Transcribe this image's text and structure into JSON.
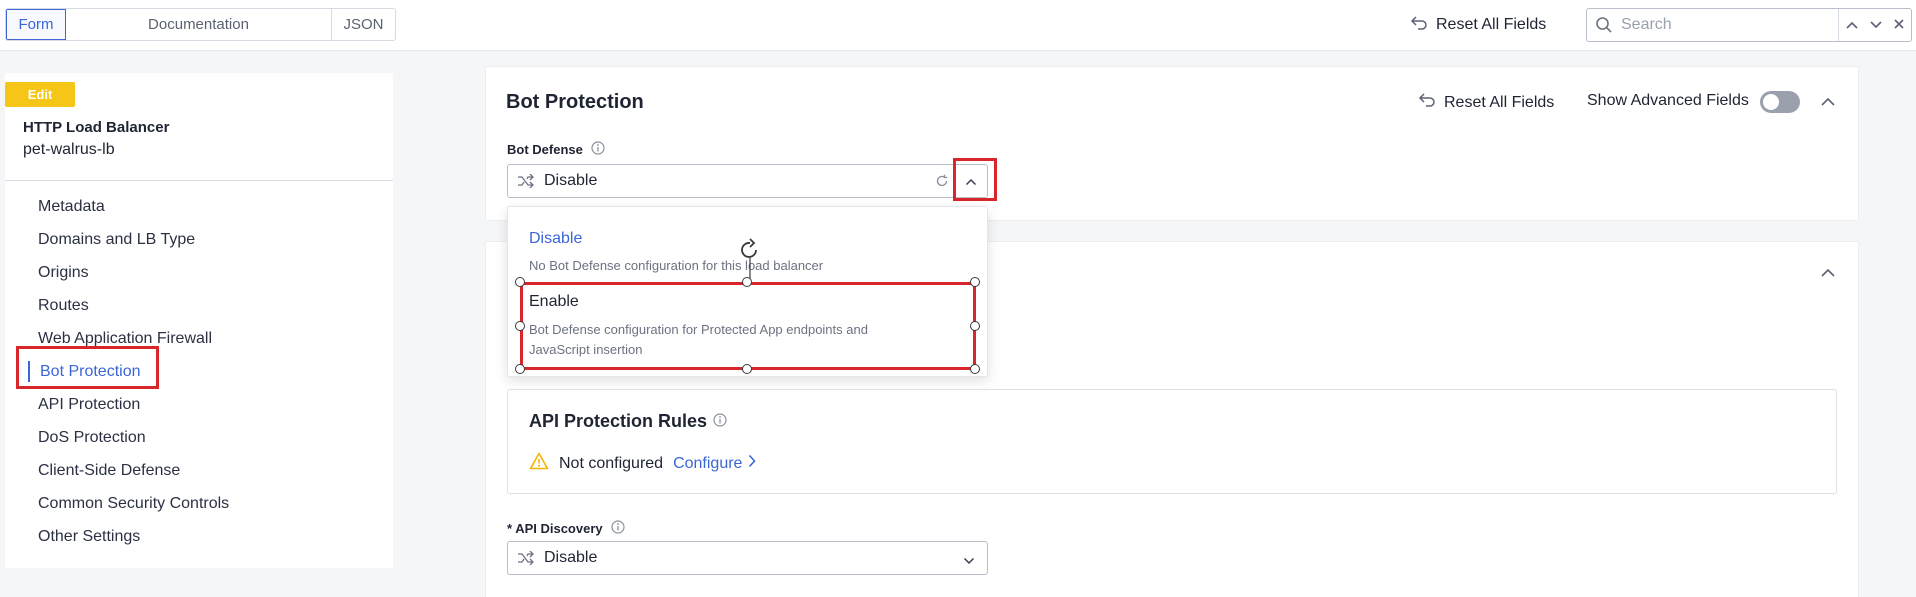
{
  "tabs": [
    {
      "label": "Form",
      "active": true
    },
    {
      "label": "Documentation",
      "active": false
    },
    {
      "label": "JSON",
      "active": false
    }
  ],
  "header": {
    "reset_label": "Reset All Fields",
    "search_placeholder": "Search"
  },
  "sidebar": {
    "badge": "Edit",
    "object_type": "HTTP Load Balancer",
    "object_name": "pet-walrus-lb",
    "items": [
      {
        "label": "Metadata"
      },
      {
        "label": "Domains and LB Type"
      },
      {
        "label": "Origins"
      },
      {
        "label": "Routes"
      },
      {
        "label": "Web Application Firewall"
      },
      {
        "label": "Bot Protection",
        "active": true
      },
      {
        "label": "API Protection"
      },
      {
        "label": "DoS Protection"
      },
      {
        "label": "Client-Side Defense"
      },
      {
        "label": "Common Security Controls"
      },
      {
        "label": "Other Settings"
      }
    ]
  },
  "bot_section": {
    "title": "Bot Protection",
    "reset_label": "Reset All Fields",
    "advanced_label": "Show Advanced Fields",
    "advanced_enabled": false,
    "bot_defense": {
      "label": "Bot Defense",
      "value": "Disable",
      "options": [
        {
          "title": "Disable",
          "description": "No Bot Defense configuration for this load balancer"
        },
        {
          "title": "Enable",
          "description": "Bot Defense configuration for Protected App endpoints and JavaScript insertion"
        }
      ]
    }
  },
  "api_section": {
    "rules_title": "API Protection Rules",
    "status": "Not configured",
    "configure_label": "Configure",
    "discovery": {
      "label": "* API Discovery",
      "value": "Disable"
    }
  },
  "colors": {
    "accent": "#3b66d6",
    "highlight": "#d9262b",
    "badge": "#f5c518",
    "warning": "#f5b400"
  }
}
